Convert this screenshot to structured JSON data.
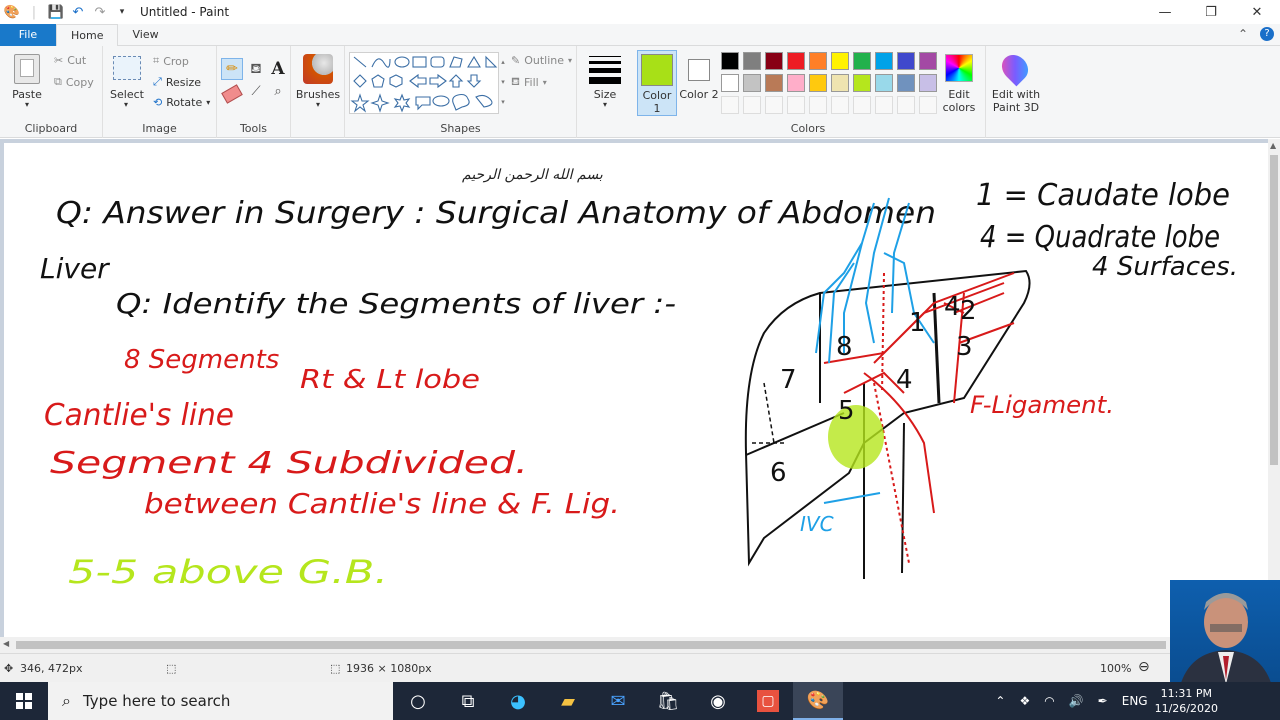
{
  "window": {
    "title": "Untitled - Paint",
    "controls": [
      "minimize",
      "maximize",
      "close"
    ]
  },
  "tabs": {
    "file": "File",
    "home": "Home",
    "view": "View"
  },
  "ribbon": {
    "clipboard": {
      "label": "Clipboard",
      "paste": "Paste",
      "cut": "Cut",
      "copy": "Copy"
    },
    "image": {
      "label": "Image",
      "select": "Select",
      "crop": "Crop",
      "resize": "Resize",
      "rotate": "Rotate"
    },
    "tools": {
      "label": "Tools"
    },
    "brushes": {
      "label": "Brushes"
    },
    "shapes": {
      "label": "Shapes",
      "outline": "Outline",
      "fill": "Fill"
    },
    "size": {
      "label": "Size"
    },
    "colors": {
      "label": "Colors",
      "color1": "Color 1",
      "color2": "Color 2",
      "edit_colors": "Edit colors",
      "edit_with_paint3d": "Edit with Paint 3D",
      "color1_value": "#a8e017",
      "color2_value": "#ffffff",
      "palette_row1": [
        "#000000",
        "#7f7f7f",
        "#880015",
        "#ed1c24",
        "#ff7f27",
        "#fff200",
        "#22b14c",
        "#00a2e8",
        "#3f48cc",
        "#a349a4"
      ],
      "palette_row2": [
        "#ffffff",
        "#c3c3c3",
        "#b97a57",
        "#ffaec9",
        "#ffc90e",
        "#efe4b0",
        "#b5e61d",
        "#99d9ea",
        "#7092be",
        "#c8bfe7"
      ]
    }
  },
  "canvas": {
    "notes": {
      "arabic": "بسم الله الرحمن الرحيم",
      "heading": "Q: Answer in Surgery : Surgical Anatomy of Abdomen",
      "liver": "Liver",
      "question": "Q: Identify the Segments of liver :-",
      "segments": "8 Segments",
      "lobes": "Rt & Lt lobe",
      "cantlie": "Cantlie's line",
      "segment4": "Segment 4 Subdivided.",
      "between": "between Cantlie's line & F. Lig.",
      "above_gb": "5-5 above G.B.",
      "caudate": "1 = Caudate lobe",
      "quadrate": "4 = Quadrate lobe",
      "surfaces": "4 Surfaces.",
      "f_ligament": "F-Ligament.",
      "ivc": "IVC"
    },
    "diagram_numbers": [
      "8",
      "4",
      "7",
      "5",
      "6",
      "3",
      "2",
      "1",
      "4"
    ]
  },
  "status": {
    "cursor_pos": "346, 472px",
    "image_size": "1936 × 1080px",
    "zoom": "100%"
  },
  "taskbar": {
    "search_placeholder": "Type here to search",
    "lang": "ENG",
    "time": "11:31 PM",
    "date": "11/26/2020"
  }
}
